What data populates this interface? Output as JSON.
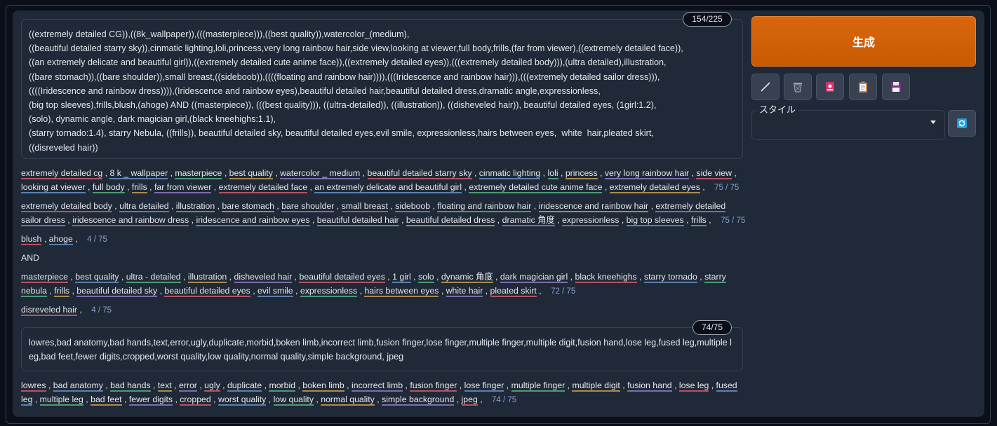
{
  "positive_prompt": {
    "text": "((extremely detailed CG)),((8k_wallpaper)),(((masterpiece))),((best quality)),watercolor_(medium),\n((beautiful detailed starry sky)),cinmatic lighting,loli,princess,very long rainbow hair,side view,looking at viewer,full body,frills,(far from viewer),((extremely detailed face)),\n((an extremely delicate and beautiful girl)),((extremely detailed cute anime face)),((extremely detailed eyes)),(((extremely detailed body))),(ultra detailed),illustration,\n((bare stomach)),((bare shoulder)),small breast,((sideboob)),((((floating and rainbow hair)))),(((Iridescence and rainbow hair))),(((extremely detailed sailor dress))),\n((((Iridescence and rainbow dress)))),(Iridescence and rainbow eyes),beautiful detailed hair,beautiful detailed dress,dramatic angle,expressionless,\n(big top sleeves),frills,blush,(ahoge) AND ((masterpiece)), (((best quality))), ((ultra-detailed)), ((illustration)), ((disheveled hair)), beautiful detailed eyes, (1girl:1.2),\n(solo), dynamic angle, dark magician girl,(black kneehighs:1.1),\n(starry tornado:1.4), starry Nebula, ((frills)), beautiful detailed sky, beautiful detailed eyes,evil smile, expressionless,hairs between eyes,  white  hair,pleated skirt,\n((disreveled hair))",
    "counter": "154/225"
  },
  "token_chunks": {
    "chunk1": {
      "tokens": [
        "extremely detailed cg",
        "8 k _ wallpaper",
        "masterpiece",
        "best quality",
        "watercolor _ medium",
        "beautiful detailed starry sky",
        "cinmatic lighting",
        "loli",
        "princess",
        "very long rainbow hair",
        "side view",
        "looking at viewer",
        "full body",
        "frills",
        "far from viewer",
        "extremely detailed face",
        "an extremely delicate and beautiful girl",
        "extremely detailed cute anime face",
        "extremely detailed eyes"
      ],
      "count": "75 / 75"
    },
    "chunk2": {
      "tokens": [
        "extremely detailed body",
        "ultra detailed",
        "illustration",
        "bare stomach",
        "bare shoulder",
        "small breast",
        "sideboob",
        "floating and rainbow hair",
        "iridescence and rainbow hair",
        "extremely detailed sailor dress",
        "iridescence and rainbow dress",
        "iridescence and rainbow eyes",
        "beautiful detailed hair",
        "beautiful detailed dress",
        "dramatic 角度",
        "expressionless",
        "big top sleeves",
        "frills"
      ],
      "count": "75 / 75"
    },
    "chunk3": {
      "tokens": [
        "blush",
        "ahoge"
      ],
      "count": "4 / 75"
    },
    "and_label": "AND",
    "chunk4": {
      "tokens": [
        "masterpiece",
        "best quality",
        "ultra - detailed",
        "illustration",
        "disheveled hair",
        "beautiful detailed eyes",
        "1 girl",
        "solo",
        "dynamic 角度",
        "dark magician girl",
        "black kneehighs",
        "starry tornado",
        "starry nebula",
        "frills",
        "beautiful detailed sky",
        "beautiful detailed eyes",
        "evil smile",
        "expressionless",
        "hairs between eyes",
        "white hair",
        "pleated skirt"
      ],
      "count": "72 / 75"
    },
    "chunk5": {
      "tokens": [
        "disreveled hair"
      ],
      "count": "4 / 75"
    }
  },
  "negative_prompt": {
    "text": "lowres,bad anatomy,bad hands,text,error,ugly,duplicate,morbid,boken limb,incorrect limb,fusion finger,lose finger,multiple finger,multiple digit,fusion hand,lose leg,fused leg,multiple leg,bad feet,fewer digits,cropped,worst quality,low quality,normal quality,simple background, jpeg",
    "counter": "74/75"
  },
  "negative_tokens": {
    "tokens": [
      "lowres",
      "bad anatomy",
      "bad hands",
      "text",
      "error",
      "ugly",
      "duplicate",
      "morbid",
      "boken limb",
      "incorrect limb",
      "fusion finger",
      "lose finger",
      "multiple finger",
      "multiple digit",
      "fusion hand",
      "lose leg",
      "fused leg",
      "multiple leg",
      "bad feet",
      "fewer digits",
      "cropped",
      "worst quality",
      "low quality",
      "normal quality",
      "simple background",
      "jpeg"
    ],
    "count": "74 / 75"
  },
  "toolbar": {
    "generate_label": "生成",
    "style_label": "スタイル",
    "style_value": "",
    "icons": [
      "pencil-icon",
      "trash-icon",
      "red-bookmark-icon",
      "clipboard-icon",
      "save-icon",
      "refresh-icon"
    ]
  },
  "colors": {
    "generate": "#d45d06",
    "background": "#0b0f19",
    "panel": "#1f2937"
  }
}
